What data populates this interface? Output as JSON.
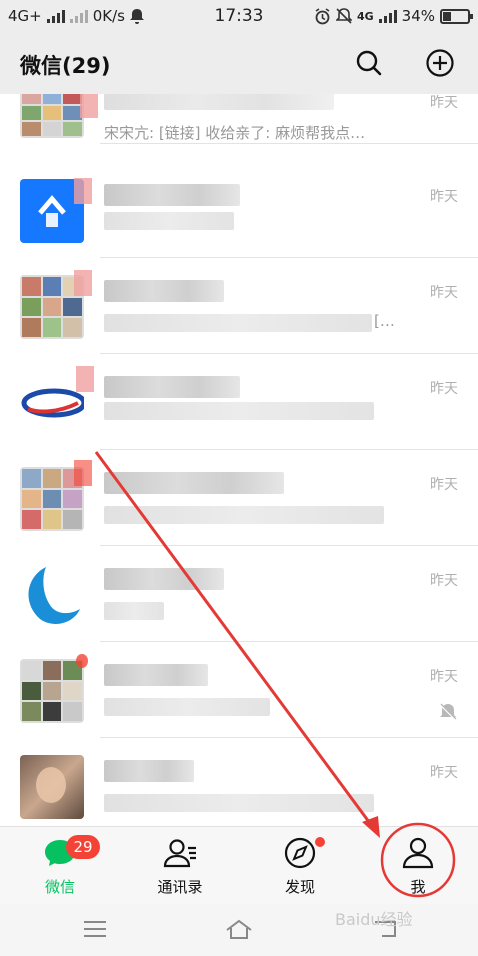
{
  "status_bar": {
    "network": "4G+",
    "speed": "0K/s",
    "time": "17:33",
    "mobile": "4G",
    "battery": "34%",
    "battery_level": 0.34
  },
  "header": {
    "title": "微信(29)"
  },
  "chats": [
    {
      "time": "昨天",
      "preview": "宋宋亢: [链接] 收给亲了: 麻烦帮我点…"
    },
    {
      "time": "昨天"
    },
    {
      "time": "昨天",
      "preview_tail": "[…"
    },
    {
      "time": "昨天"
    },
    {
      "time": "昨天"
    },
    {
      "time": "昨天"
    },
    {
      "time": "昨天",
      "muted": true
    },
    {
      "time": "昨天"
    }
  ],
  "nav": {
    "chats": {
      "label": "微信",
      "badge": "29"
    },
    "contacts": {
      "label": "通讯录"
    },
    "discover": {
      "label": "发现"
    },
    "me": {
      "label": "我"
    }
  },
  "colors": {
    "accent": "#07c160",
    "badge": "#f44336",
    "annotation": "#e53935"
  },
  "watermark": "Baidu经验"
}
